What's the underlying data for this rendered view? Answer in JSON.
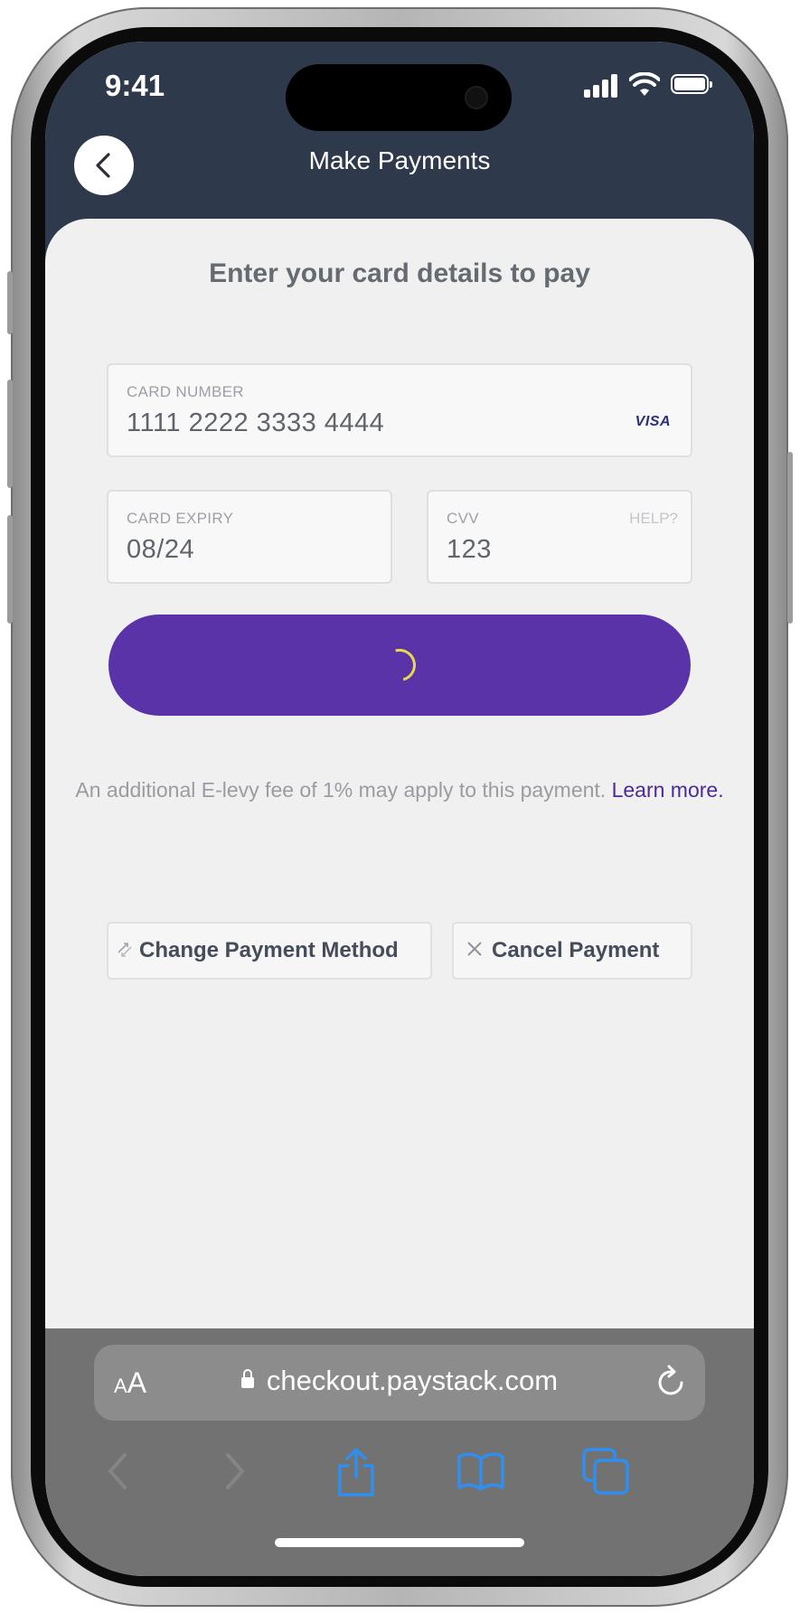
{
  "status_bar": {
    "time": "9:41"
  },
  "header": {
    "title": "Make Payments",
    "back_icon": "chevron-left-icon"
  },
  "form": {
    "heading": "Enter your card details to pay",
    "card_number": {
      "label": "CARD NUMBER",
      "value": "1111 2222 3333 4444",
      "brand": "VISA"
    },
    "card_expiry": {
      "label": "CARD EXPIRY",
      "value": "08/24"
    },
    "cvv": {
      "label": "CVV",
      "value": "123",
      "help": "HELP?"
    },
    "pay_button": {
      "state": "loading",
      "color": "#5a33a9",
      "spinner_color": "#e8da4a"
    }
  },
  "notice": {
    "text": "An additional E-levy fee of 1% may apply to this payment. ",
    "link": "Learn more."
  },
  "actions": {
    "change_method": "Change Payment Method",
    "cancel": "Cancel Payment"
  },
  "browser": {
    "aa_small": "A",
    "aa_big": "A",
    "url": "checkout.paystack.com"
  },
  "colors": {
    "header_bg": "#2e394c",
    "accent": "#5a33a9",
    "link": "#4b2a9a",
    "browser_bg": "#727272",
    "toolbar_active": "#2f8ef0"
  }
}
